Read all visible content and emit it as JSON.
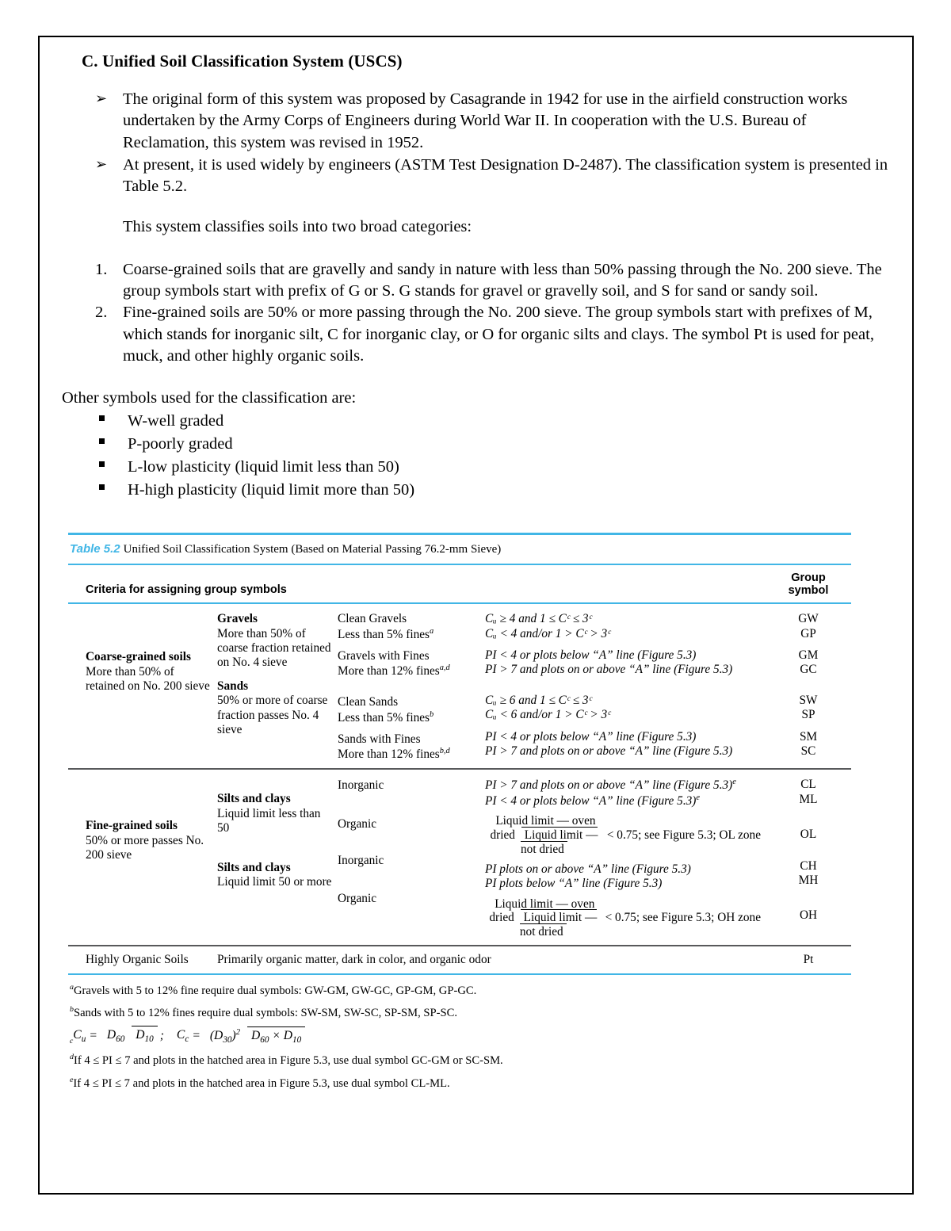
{
  "document": {
    "heading": "C. Unified Soil Classification System (USCS)",
    "arrow_bullets": [
      "The original form of this system was proposed by Casagrande in 1942 for use in the airfield construction works undertaken by the Army Corps of Engineers during World War II. In cooperation with the U.S. Bureau of Reclamation, this system was revised in 1952.",
      "At present, it is used widely by engineers (ASTM Test Designation D-2487). The classification system is presented in Table 5.2."
    ],
    "arrow_marker": "➢",
    "lead_line": "This system classifies soils into two broad categories:",
    "numbered_items": [
      {
        "marker": "1.",
        "text": "Coarse-grained soils that are gravelly and sandy in nature with less than 50% passing through the No. 200 sieve. The group symbols start with prefix of G or S. G stands for gravel or gravelly soil, and S for sand or sandy soil."
      },
      {
        "marker": "2.",
        "text": "Fine-grained soils are 50% or more passing through the No. 200 sieve. The group symbols start with prefixes of M, which stands for inorganic silt, C for inorganic clay, or O for organic silts and clays. The symbol Pt is used for peat, muck, and other highly organic soils."
      }
    ],
    "other_symbols_intro": "Other symbols used for the classification are:",
    "symbol_bullets": [
      "W-well graded",
      "P-poorly graded",
      "L-low plasticity (liquid limit less than 50)",
      "H-high plasticity (liquid limit more than 50)"
    ]
  },
  "table": {
    "caption_number": "Table 5.2",
    "caption_text": "Unified Soil Classification System (Based on Material Passing 76.2-mm Sieve)",
    "header_criteria": "Criteria for assigning group symbols",
    "header_group_line1": "Group",
    "header_group_line2": "symbol",
    "coarse": {
      "category_bold": "Coarse-grained soils",
      "category_rest": "More than 50% of retained on No. 200 sieve",
      "divisions": [
        {
          "name": "Gravels",
          "detail": "More than 50% of coarse fraction retained on No. 4 sieve",
          "groups": [
            {
              "sub_line1": "Clean Gravels",
              "sub_line2": "Less than 5% fines",
              "sub_sup": "a",
              "criteria": [
                "Cᵤ ≥ 4 and 1 ≤ Cᶜ ≤ 3ᶜ",
                "Cᵤ < 4 and/or 1 > Cᶜ > 3ᶜ"
              ],
              "symbols": [
                "GW",
                "GP"
              ]
            },
            {
              "sub_line1": "Gravels with Fines",
              "sub_line2": "More than 12% fines",
              "sub_sup": "a,d",
              "criteria": [
                "PI < 4 or plots below “A” line (Figure 5.3)",
                "PI > 7 and plots on or above “A” line (Figure 5.3)"
              ],
              "symbols": [
                "GM",
                "GC"
              ]
            }
          ]
        },
        {
          "name": "Sands",
          "detail": "50% or more of coarse fraction passes No. 4 sieve",
          "groups": [
            {
              "sub_line1": "Clean Sands",
              "sub_line2": "Less than 5% fines",
              "sub_sup": "b",
              "criteria": [
                "Cᵤ ≥ 6 and 1 ≤ Cᶜ ≤ 3ᶜ",
                "Cᵤ < 6 and/or 1 > Cᶜ > 3ᶜ"
              ],
              "symbols": [
                "SW",
                "SP"
              ]
            },
            {
              "sub_line1": "Sands with Fines",
              "sub_line2": "More than 12% fines",
              "sub_sup": "b,d",
              "criteria": [
                "PI < 4 or plots below “A” line (Figure 5.3)",
                "PI > 7 and plots on or above “A” line (Figure 5.3)"
              ],
              "symbols": [
                "SM",
                "SC"
              ]
            }
          ]
        }
      ]
    },
    "fine": {
      "category_bold": "Fine-grained soils",
      "category_rest": "50% or more passes No. 200 sieve",
      "divisions": [
        {
          "name": "Silts and clays",
          "detail": "Liquid limit less than 50",
          "inorganic_label": "Inorganic",
          "organic_label": "Organic",
          "inorganic_criteria": [
            "PI > 7 and plots on or above “A” line (Figure 5.3)",
            "PI < 4 or plots below “A” line (Figure 5.3)"
          ],
          "inorganic_crit_sup": [
            "e",
            "e"
          ],
          "inorganic_symbols": [
            "CL",
            "ML"
          ],
          "organic_frac_num": "Liquid limit — oven dried",
          "organic_frac_den": "Liquid limit — not dried",
          "organic_frac_tail": "< 0.75; see Figure 5.3; OL zone",
          "organic_symbol": "OL"
        },
        {
          "name": "Silts and clays",
          "detail": "Liquid limit 50 or more",
          "inorganic_label": "Inorganic",
          "organic_label": "Organic",
          "inorganic_criteria": [
            "PI plots on or above “A” line (Figure 5.3)",
            "PI plots below “A” line (Figure 5.3)"
          ],
          "inorganic_crit_sup": [
            "",
            ""
          ],
          "inorganic_symbols": [
            "CH",
            "MH"
          ],
          "organic_frac_num": "Liquid limit — oven dried",
          "organic_frac_den": "Liquid limit — not dried",
          "organic_frac_tail": "< 0.75; see Figure 5.3; OH zone",
          "organic_symbol": "OH"
        }
      ]
    },
    "organic_row": {
      "label": "Highly Organic Soils",
      "description": "Primarily organic matter, dark in color, and organic odor",
      "symbol": "Pt"
    },
    "footnotes": [
      {
        "mark": "a",
        "text": "Gravels with 5 to 12% fine require dual symbols: GW-GM, GW-GC, GP-GM, GP-GC."
      },
      {
        "mark": "b",
        "text": "Sands with 5 to 12% fines require dual symbols: SW-SM, SW-SC, SP-SM, SP-SC."
      }
    ],
    "formula_footnote": {
      "mark": "c",
      "cu_label": "C",
      "cu_sub": "u",
      "cu_num": "D",
      "cu_num_sub": "60",
      "cu_den": "D",
      "cu_den_sub": "10",
      "cc_label": "C",
      "cc_sub": "c",
      "cc_num": "(D",
      "cc_num_sub": "30",
      "cc_num_pow": "2",
      "cc_den_a": "D",
      "cc_den_a_sub": "60",
      "cc_den_times": "×",
      "cc_den_b": "D",
      "cc_den_b_sub": "10"
    },
    "footnotes_tail": [
      {
        "mark": "d",
        "text": "If 4 ≤ PI ≤ 7 and plots in the hatched area in Figure 5.3, use dual symbol GC-GM or SC-SM."
      },
      {
        "mark": "e",
        "text": "If 4 ≤ PI ≤ 7 and plots in the hatched area in Figure 5.3, use dual symbol CL-ML."
      }
    ]
  },
  "colors": {
    "rule_blue": "#41b6e6",
    "rule_dark": "#58595b",
    "rule_gray": "#a7a9ac",
    "text": "#000000"
  }
}
